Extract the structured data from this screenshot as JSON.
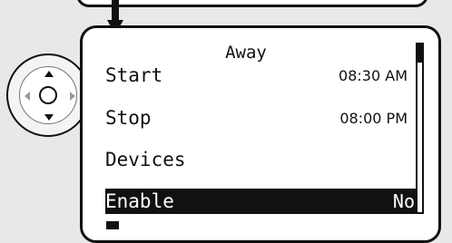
{
  "screen": {
    "title": "Away",
    "rows": [
      {
        "label": "Start",
        "value": "08:30 AM"
      },
      {
        "label": "Stop",
        "value": "08:00 PM"
      },
      {
        "label": "Devices",
        "value": ""
      },
      {
        "label": "Enable",
        "value": "No",
        "selected": true
      }
    ]
  },
  "scrollbar": {
    "position_fraction": 0
  },
  "navigation": {
    "icons": [
      "arrow-up-icon",
      "arrow-down-icon",
      "arrow-left-icon",
      "arrow-right-icon",
      "select-button"
    ]
  },
  "colors": {
    "lcd_background": "#ffffff",
    "lcd_text": "#111111",
    "highlight_background": "#111111",
    "highlight_text": "#ffffff",
    "frame_background": "#e8e8e8"
  }
}
